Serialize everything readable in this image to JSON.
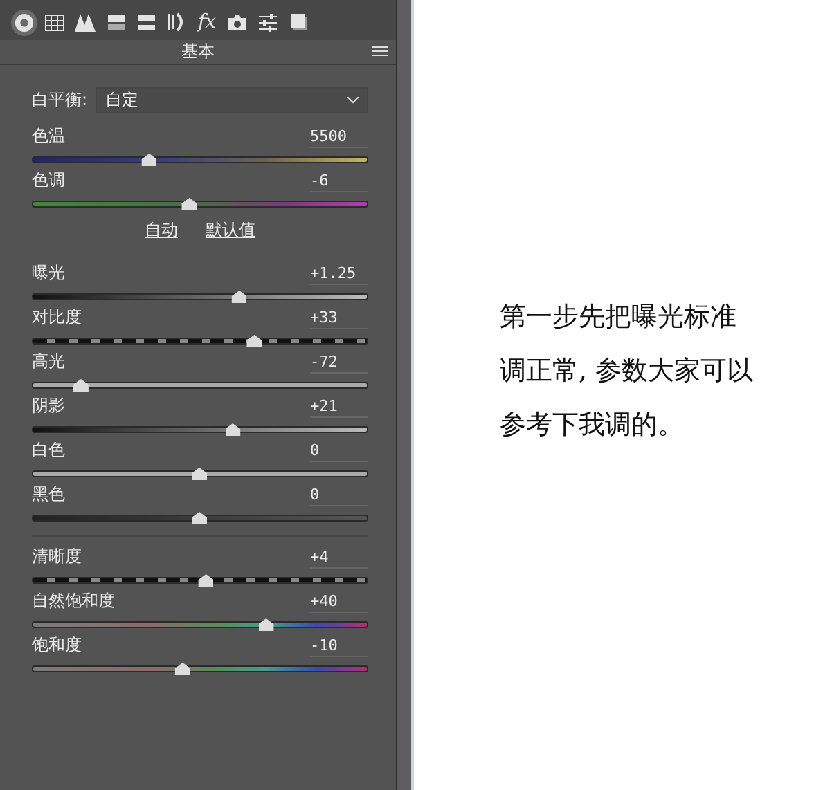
{
  "toolbar": {
    "tabs": [
      {
        "selected": true
      },
      {
        "selected": false
      },
      {
        "selected": false
      },
      {
        "selected": false
      },
      {
        "selected": false
      },
      {
        "selected": false
      },
      {
        "label": "fx",
        "selected": false
      },
      {
        "selected": false
      },
      {
        "selected": false
      },
      {
        "selected": false
      }
    ]
  },
  "panel": {
    "title": "基本",
    "white_balance": {
      "label": "白平衡:",
      "value": "自定"
    },
    "groups": [
      {
        "sliders": [
          {
            "label": "色温",
            "value": "5500",
            "level": 0.35,
            "kind": "temperature"
          },
          {
            "label": "色调",
            "value": "-6",
            "level": 0.47,
            "kind": "tint"
          }
        ],
        "links": [
          "自动",
          "默认值"
        ]
      },
      {
        "sliders": [
          {
            "label": "曝光",
            "value": "+1.25",
            "level": 0.62,
            "kind": "dark-light"
          },
          {
            "label": "对比度",
            "value": "+33",
            "level": 0.665,
            "kind": "dashed"
          },
          {
            "label": "高光",
            "value": "-72",
            "level": 0.145,
            "kind": "light"
          },
          {
            "label": "阴影",
            "value": "+21",
            "level": 0.6,
            "kind": "dark-light"
          },
          {
            "label": "白色",
            "value": "0",
            "level": 0.5,
            "kind": "light"
          },
          {
            "label": "黑色",
            "value": "0",
            "level": 0.5,
            "kind": "dark"
          }
        ]
      },
      {
        "sliders": [
          {
            "label": "清晰度",
            "value": "+4",
            "level": 0.52,
            "kind": "dashed"
          },
          {
            "label": "自然饱和度",
            "value": "+40",
            "level": 0.7,
            "kind": "spectrum"
          },
          {
            "label": "饱和度",
            "value": "-10",
            "level": 0.45,
            "kind": "spectrum"
          }
        ]
      }
    ]
  },
  "caption": {
    "lines": [
      "第一步先把曝光标准",
      "调正常, 参数大家可以",
      "参考下我调的。"
    ]
  }
}
